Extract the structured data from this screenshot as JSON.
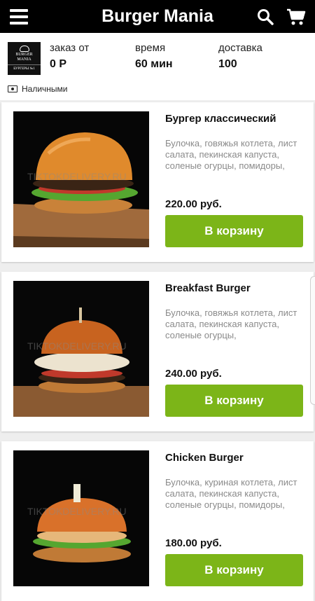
{
  "header": {
    "title": "Burger Mania",
    "icons": [
      "menu-icon",
      "search-icon",
      "cart-icon"
    ]
  },
  "restaurant": {
    "logo_text": {
      "line1": "BURGER",
      "line2": "MANIA",
      "line3": "БУРГЕРЫ №1"
    },
    "min_order_label": "заказ от",
    "min_order_value": "0 Р",
    "time_label": "время",
    "time_value": "60 мин",
    "delivery_label": "доставка",
    "delivery_value": "100",
    "payment_icon": "cash-icon",
    "payment_label": "Наличными"
  },
  "colors": {
    "header_bg": "#000000",
    "accent_button": "#7cb518"
  },
  "products": [
    {
      "name": "Бургер классический",
      "description": "Булочка, говяжья котлета, лист салата, пекинская капуста, соленые огурцы, помидоры,",
      "price": "220.00 руб.",
      "button_label": "В корзину",
      "watermark": "TIKTOKDELIVERY.RU"
    },
    {
      "name": "Breakfast Burger",
      "description": "Булочка, говяжья котлета, лист салата, пекинская капуста, соленые огурцы,",
      "price": "240.00 руб.",
      "button_label": "В корзину",
      "watermark": "TIKTOKDELIVERY.RU"
    },
    {
      "name": "Chicken Burger",
      "description": "Булочка, куриная котлета, лист салата, пекинская капуста, соленые огурцы, помидоры,",
      "price": "180.00 руб.",
      "button_label": "В корзину",
      "watermark": "TIKTOKDELIVERY.RU"
    }
  ]
}
